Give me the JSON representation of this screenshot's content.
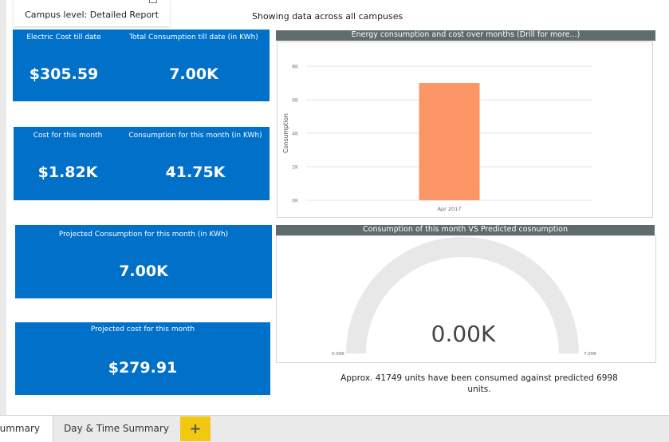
{
  "report": {
    "title_box": "Campus level: Detailed Report",
    "subtitle": "Showing data across all campuses"
  },
  "cards": [
    {
      "header": "Electric Cost till date",
      "value": "$305.59"
    },
    {
      "header": "Total Consumption till date (in KWh)",
      "value": "7.00K"
    },
    {
      "header": "Cost for this month",
      "value": "$1.82K"
    },
    {
      "header": "Consumption for this month (in KWh)",
      "value": "41.75K"
    },
    {
      "header": "Projected Consumption for this month (in KWh)",
      "value": "7.00K"
    },
    {
      "header": "Projected cost for this month",
      "value": "$279.91"
    }
  ],
  "bar_chart": {
    "title": "Energy consumption and cost over months (Drill for more...)",
    "chart_data": {
      "type": "bar",
      "categories": [
        "Apr 2017"
      ],
      "values": [
        7000
      ],
      "ylabel": "Consumption",
      "ylim": [
        0,
        8000
      ],
      "yticks": [
        "0K",
        "2K",
        "4K",
        "6K",
        "8K"
      ],
      "grid": true,
      "colors": {
        "bar": "#fd9666",
        "grid": "#e6e6e6"
      }
    }
  },
  "gauge": {
    "title": "Consumption of this month VS Predicted cosnumption",
    "value_label": "0.00K",
    "min_label": "0.00K",
    "max_label": "7.00K",
    "colors": {
      "track": "#e8e8e8",
      "fill": "#0070c9"
    },
    "value_fraction": 0
  },
  "footnote": "Approx. 41749 units have been consumed against predicted 6998 units.",
  "tabs": [
    {
      "label": "Summary",
      "active": true
    },
    {
      "label": "Day & Time Summary",
      "active": false
    }
  ],
  "add_tab": "+"
}
